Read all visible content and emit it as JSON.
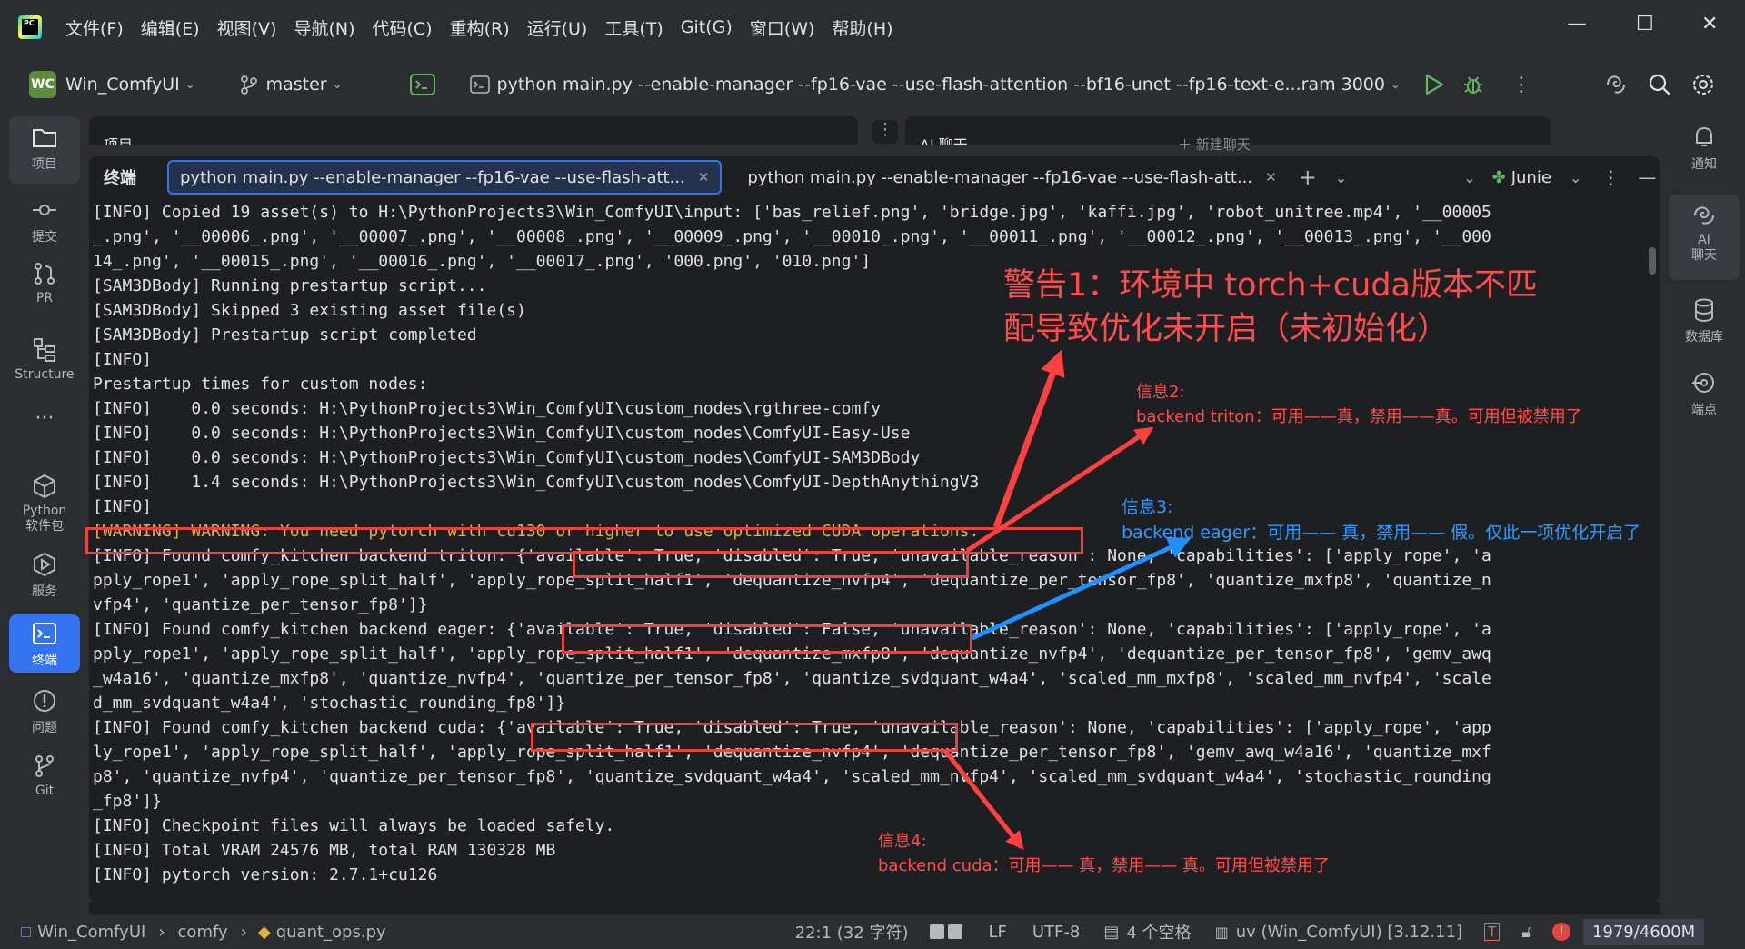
{
  "menubar": {
    "items": [
      "文件(F)",
      "编辑(E)",
      "视图(V)",
      "导航(N)",
      "代码(C)",
      "重构(R)",
      "运行(U)",
      "工具(T)",
      "Git(G)",
      "窗口(W)",
      "帮助(H)"
    ],
    "logo_text": "PC"
  },
  "toolbar": {
    "project_badge": "WC",
    "project_name": "Win_ComfyUI",
    "branch": "master",
    "run_config": "python main.py --enable-manager --fp16-vae --use-flash-attention --bf16-unet --fp16-text-e...ram 3000"
  },
  "left_tools": [
    {
      "label": "项目",
      "icon": "folder-icon"
    },
    {
      "label": "提交",
      "icon": "commit-icon"
    },
    {
      "label": "PR",
      "icon": "pull-request-icon"
    },
    {
      "label": "Structure",
      "icon": "structure-icon"
    },
    {
      "label": "Python\n软件包",
      "icon": "python-packages-icon"
    },
    {
      "label": "服务",
      "icon": "services-icon"
    },
    {
      "label": "终端",
      "icon": "terminal-icon"
    },
    {
      "label": "问题",
      "icon": "problems-icon"
    },
    {
      "label": "Git",
      "icon": "git-icon"
    }
  ],
  "right_tools": [
    {
      "label": "通知",
      "icon": "bell-icon"
    },
    {
      "label": "AI\n聊天",
      "icon": "ai-chat-icon"
    },
    {
      "label": "数据库",
      "icon": "database-icon"
    },
    {
      "label": "端点",
      "icon": "endpoints-icon"
    }
  ],
  "panels": {
    "project_label": "项目",
    "ai_label": "AI 聊天",
    "ai_new_chat": "新建聊天"
  },
  "terminal": {
    "title": "终端",
    "tabs": [
      {
        "label": "python main.py --enable-manager --fp16-vae --use-flash-att..."
      },
      {
        "label": "python main.py --enable-manager --fp16-vae --use-flash-att..."
      }
    ],
    "junie": "Junie",
    "lines": [
      "[INFO] Copied 19 asset(s) to H:\\PythonProjects3\\Win_ComfyUI\\input: ['bas_relief.png', 'bridge.jpg', 'kaffi.jpg', 'robot_unitree.mp4', '__00005",
      "_.png', '__00006_.png', '__00007_.png', '__00008_.png', '__00009_.png', '__00010_.png', '__00011_.png', '__00012_.png', '__00013_.png', '__000",
      "14_.png', '__00015_.png', '__00016_.png', '__00017_.png', '000.png', '010.png']",
      "[SAM3DBody] Running prestartup script...",
      "[SAM3DBody] Skipped 3 existing asset file(s)",
      "[SAM3DBody] Prestartup script completed",
      "[INFO]",
      "Prestartup times for custom nodes:",
      "[INFO]    0.0 seconds: H:\\PythonProjects3\\Win_ComfyUI\\custom_nodes\\rgthree-comfy",
      "[INFO]    0.0 seconds: H:\\PythonProjects3\\Win_ComfyUI\\custom_nodes\\ComfyUI-Easy-Use",
      "[INFO]    0.0 seconds: H:\\PythonProjects3\\Win_ComfyUI\\custom_nodes\\ComfyUI-SAM3DBody",
      "[INFO]    1.4 seconds: H:\\PythonProjects3\\Win_ComfyUI\\custom_nodes\\ComfyUI-DepthAnythingV3",
      "[INFO]",
      "[WARNING] WARNING: You need pytorch with cu130 or higher to use optimized CUDA operations.",
      "[INFO] Found comfy_kitchen backend triton: {'available': True, 'disabled': True, 'unavailable_reason': None, 'capabilities': ['apply_rope', 'a",
      "pply_rope1', 'apply_rope_split_half', 'apply_rope_split_half1', 'dequantize_nvfp4', 'dequantize_per_tensor_fp8', 'quantize_mxfp8', 'quantize_n",
      "vfp4', 'quantize_per_tensor_fp8']}",
      "[INFO] Found comfy_kitchen backend eager: {'available': True, 'disabled': False, 'unavailable_reason': None, 'capabilities': ['apply_rope', 'a",
      "pply_rope1', 'apply_rope_split_half', 'apply_rope_split_half1', 'dequantize_mxfp8', 'dequantize_nvfp4', 'dequantize_per_tensor_fp8', 'gemv_awq",
      "_w4a16', 'quantize_mxfp8', 'quantize_nvfp4', 'quantize_per_tensor_fp8', 'quantize_svdquant_w4a4', 'scaled_mm_mxfp8', 'scaled_mm_nvfp4', 'scale",
      "d_mm_svdquant_w4a4', 'stochastic_rounding_fp8']}",
      "[INFO] Found comfy_kitchen backend cuda: {'available': True, 'disabled': True, 'unavailable_reason': None, 'capabilities': ['apply_rope', 'app",
      "ly_rope1', 'apply_rope_split_half', 'apply_rope_split_half1', 'dequantize_nvfp4', 'dequantize_per_tensor_fp8', 'gemv_awq_w4a16', 'quantize_mxf",
      "p8', 'quantize_nvfp4', 'quantize_per_tensor_fp8', 'quantize_svdquant_w4a4', 'scaled_mm_nvfp4', 'scaled_mm_svdquant_w4a4', 'stochastic_rounding",
      "_fp8']}",
      "[INFO] Checkpoint files will always be loaded safely.",
      "[INFO] Total VRAM 24576 MB, total RAM 130328 MB",
      "[INFO] pytorch version: 2.7.1+cu126"
    ]
  },
  "annotations": {
    "warning1_line1": "警告1：环境中 torch+cuda版本不匹",
    "warning1_line2": "配导致优化未开启（未初始化）",
    "info2_title": "信息2:",
    "info2_body": "backend triton：可用——真，禁用——真。可用但被禁用了",
    "info3_title": "信息3:",
    "info3_body": "backend eager：可用—— 真，禁用—— 假。仅此一项优化开启了",
    "info4_title": "信息4:",
    "info4_body": "backend cuda：可用—— 真，禁用—— 真。可用但被禁用了",
    "colors": {
      "red": "#ff3b3b",
      "blue": "#1e90ff"
    }
  },
  "statusbar": {
    "breadcrumb": [
      "Win_ComfyUI",
      "comfy",
      "quant_ops.py"
    ],
    "position": "22:1 (32 字符)",
    "line_sep": "LF",
    "encoding": "UTF-8",
    "indent": "4 个空格",
    "interpreter": "uv (Win_ComfyUI) [3.12.11]",
    "memory": "1979/4600M"
  }
}
